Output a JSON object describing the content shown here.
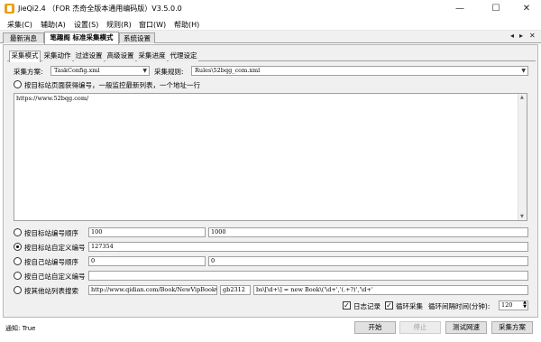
{
  "window": {
    "title": "JieQi2.4 （FOR 杰奇全版本通用编码版）V3.5.0.0",
    "minimize": "—",
    "maximize": "☐",
    "close": "✕"
  },
  "menu": [
    "采集(C)",
    "辅助(A)",
    "设置(S)",
    "规则(R)",
    "窗口(W)",
    "帮助(H)"
  ],
  "outer_tabs": [
    "最新消息",
    "笔趣阁 标准采集模式",
    "系统设置"
  ],
  "tab_controls": {
    "prev": "◂",
    "next": "▸",
    "close": "✕"
  },
  "inner_tabs": [
    "采集模式",
    "采集动作",
    "过滤设置",
    "高级设置",
    "采集进度",
    "代理设定"
  ],
  "scheme": {
    "label": "采集方案:",
    "value": "TaskConfig.xml"
  },
  "rule": {
    "label": "采集规则:",
    "value": "Rules\\52bqg_com.xml"
  },
  "option_list_label": "按目标站页面获得编号，一般监控最新列表，一个地址一行",
  "textarea_value": "https://www.52bqg.com/",
  "options": {
    "target_seq": {
      "label": "按目标站编号顺序",
      "from": "100",
      "to": "1000"
    },
    "target_custom": {
      "label": "按目标站自定义编号",
      "value": "127354"
    },
    "own_seq": {
      "label": "按自己站编号顺序",
      "from": "0",
      "to": "0"
    },
    "own_custom": {
      "label": "按自己站自定义编号",
      "value": ""
    },
    "other_list": {
      "label": "按其他站列表搜索",
      "url": "http://www.qidian.com/Book/NewVipBookC",
      "encoding": "gb2312",
      "pattern": "bs\\[\\d+\\] = new Book\\('\\d+','(.+?)','\\d+'"
    }
  },
  "checks": {
    "log": "日志记录",
    "loop": "循环采集",
    "interval_label": "循环间隔时间(分钟):",
    "interval": "120"
  },
  "buttons": {
    "start": "开始",
    "stop": "停止",
    "test": "测试网速",
    "scheme": "采集方案"
  },
  "status": "通知: True"
}
